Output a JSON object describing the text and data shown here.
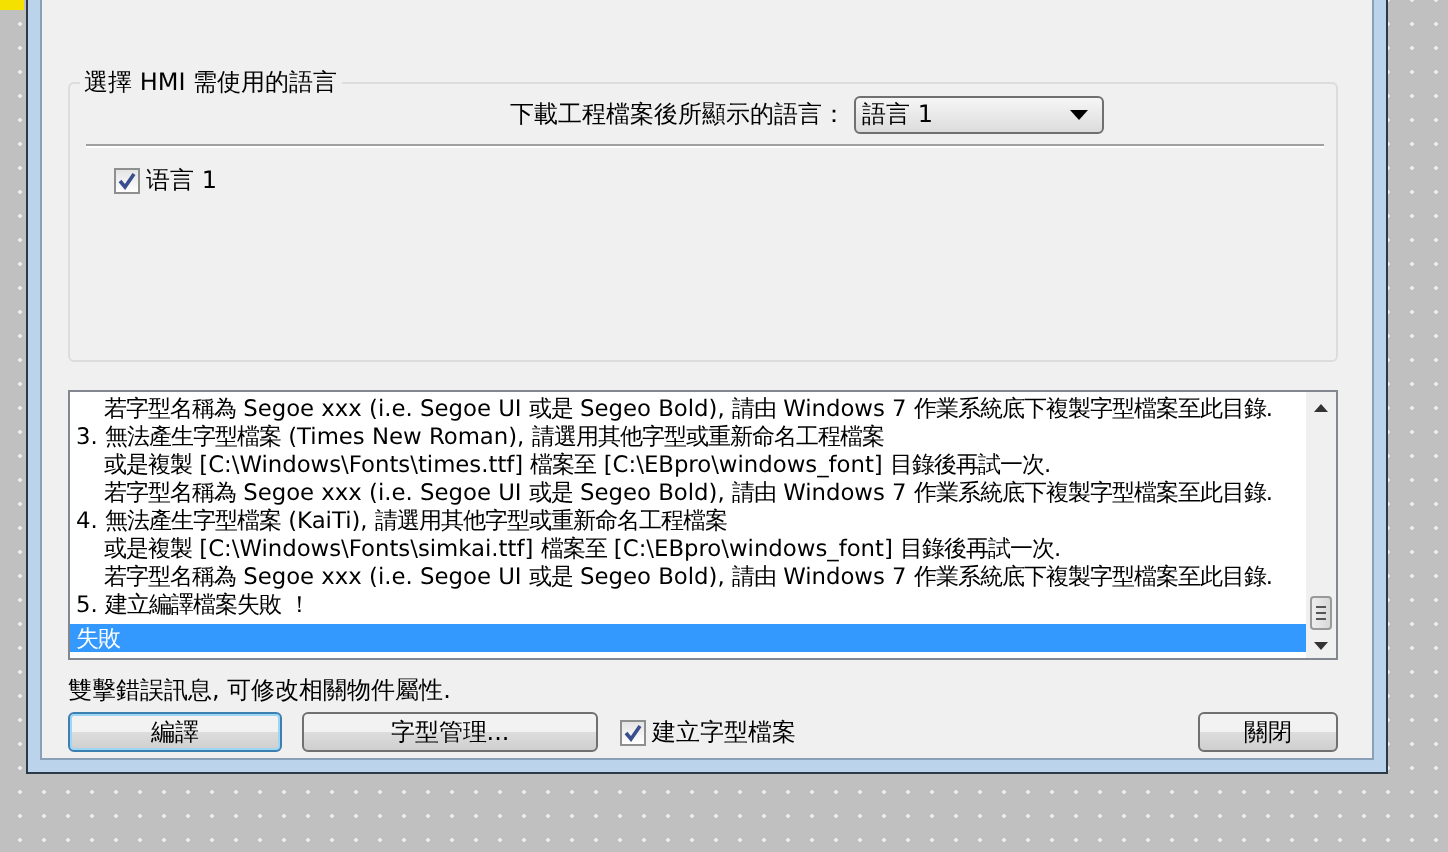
{
  "language_group": {
    "title": "選擇 HMI 需使用的語言",
    "display_label": "下載工程檔案後所顯示的語言：",
    "display_select": {
      "value": "語言 1"
    },
    "languages": [
      {
        "label": "语言 1",
        "checked": true
      }
    ]
  },
  "log": {
    "lines": [
      {
        "text": "若字型名稱為 Segoe xxx (i.e. Segoe UI 或是 Segeo Bold), 請由 Windows 7 作業系統底下複製字型檔案至此目錄.",
        "kind": "detail",
        "selected": false
      },
      {
        "text": "3. 無法產生字型檔案 (Times New Roman), 請選用其他字型或重新命名工程檔案",
        "kind": "item",
        "selected": false
      },
      {
        "text": "或是複製 [C:\\Windows\\Fonts\\times.ttf] 檔案至 [C:\\EBpro\\windows_font] 目錄後再試一次.",
        "kind": "detail",
        "selected": false
      },
      {
        "text": "若字型名稱為 Segoe xxx (i.e. Segoe UI 或是 Segeo Bold), 請由 Windows 7 作業系統底下複製字型檔案至此目錄.",
        "kind": "detail",
        "selected": false
      },
      {
        "text": "4. 無法產生字型檔案 (KaiTi), 請選用其他字型或重新命名工程檔案",
        "kind": "item",
        "selected": false
      },
      {
        "text": "或是複製 [C:\\Windows\\Fonts\\simkai.ttf] 檔案至 [C:\\EBpro\\windows_font] 目錄後再試一次.",
        "kind": "detail",
        "selected": false
      },
      {
        "text": "若字型名稱為 Segoe xxx (i.e. Segoe UI 或是 Segeo Bold), 請由 Windows 7 作業系統底下複製字型檔案至此目錄.",
        "kind": "detail",
        "selected": false
      },
      {
        "text": "5. 建立編譯檔案失敗 ！",
        "kind": "item",
        "selected": false
      },
      {
        "text": "失敗",
        "kind": "result",
        "selected": true
      }
    ]
  },
  "hint": "雙擊錯誤訊息, 可修改相關物件屬性.",
  "buttons": {
    "compile": "編譯",
    "font_manager": "字型管理...",
    "create_font": {
      "label": "建立字型檔案",
      "checked": true
    },
    "close": "關閉"
  }
}
